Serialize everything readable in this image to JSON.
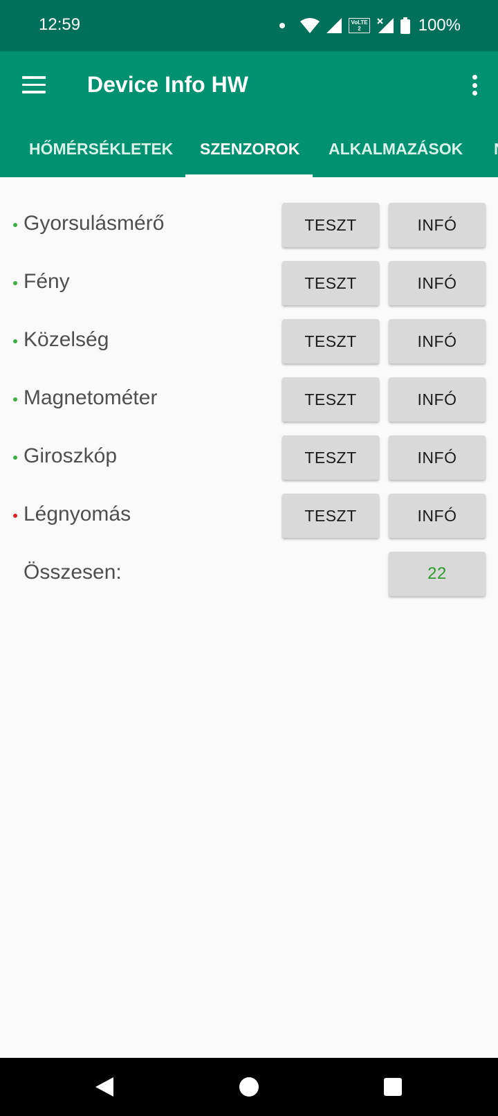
{
  "status_bar": {
    "time": "12:59",
    "volte_label": "VoLTE",
    "volte_sub": "2",
    "battery": "100%"
  },
  "app_bar": {
    "title": "Device Info HW"
  },
  "tabs": [
    {
      "label": "HŐMÉRSÉKLETEK",
      "active": false
    },
    {
      "label": "SZENZOROK",
      "active": true
    },
    {
      "label": "ALKALMAZÁSOK",
      "active": false
    },
    {
      "label": "N",
      "active": false
    }
  ],
  "sensors": [
    {
      "name": "Gyorsulásmérő",
      "status": "ok",
      "test_label": "TESZT",
      "info_label": "INFÓ"
    },
    {
      "name": "Fény",
      "status": "ok",
      "test_label": "TESZT",
      "info_label": "INFÓ"
    },
    {
      "name": "Közelség",
      "status": "ok",
      "test_label": "TESZT",
      "info_label": "INFÓ"
    },
    {
      "name": "Magnetométer",
      "status": "ok",
      "test_label": "TESZT",
      "info_label": "INFÓ"
    },
    {
      "name": "Giroszkóp",
      "status": "ok",
      "test_label": "TESZT",
      "info_label": "INFÓ"
    },
    {
      "name": "Légnyomás",
      "status": "missing",
      "test_label": "TESZT",
      "info_label": "INFÓ"
    }
  ],
  "total": {
    "label": "Összesen:",
    "value": "22"
  },
  "colors": {
    "status_bar": "#00705a",
    "app_bar": "#009170",
    "ok_bullet": "#3cb043",
    "missing_bullet": "#e02020",
    "total_value": "#2e9a2e"
  }
}
